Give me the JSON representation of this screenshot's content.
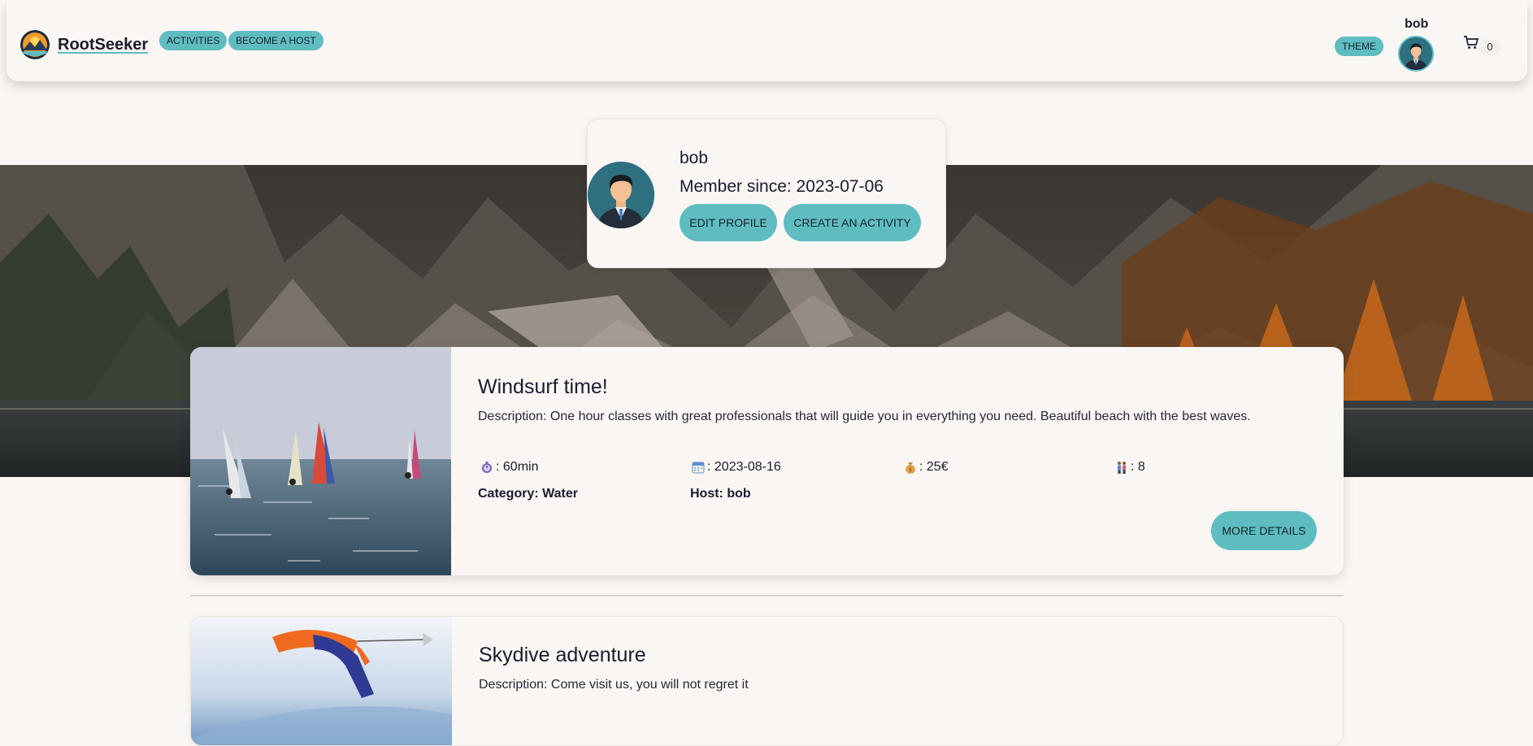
{
  "navbar": {
    "brand": "RootSeeker",
    "activities": "ACTIVITIES",
    "become_host": "BECOME A HOST",
    "theme": "THEME",
    "username": "bob",
    "cart_count": "0"
  },
  "profile": {
    "name": "bob",
    "member_since": "Member since: 2023-07-06",
    "edit_profile": "EDIT PROFILE",
    "create_activity": "CREATE AN ACTIVITY"
  },
  "activities": [
    {
      "title": "Windsurf time!",
      "description": "Description: One hour classes with great professionals that will guide you in everything you need. Beautiful beach with the best waves.",
      "duration": ": 60min",
      "date": ": 2023-08-16",
      "price": ": 25€",
      "people": ": 8",
      "category": "Category: Water",
      "host": "Host: bob",
      "more_details": "MORE DETAILS"
    },
    {
      "title": "Skydive adventure",
      "description": "Description: Come visit us, you will not regret it"
    }
  ],
  "colors": {
    "accent": "#5fbdc2",
    "background": "#faf6f3",
    "text": "#1e1a2e"
  }
}
